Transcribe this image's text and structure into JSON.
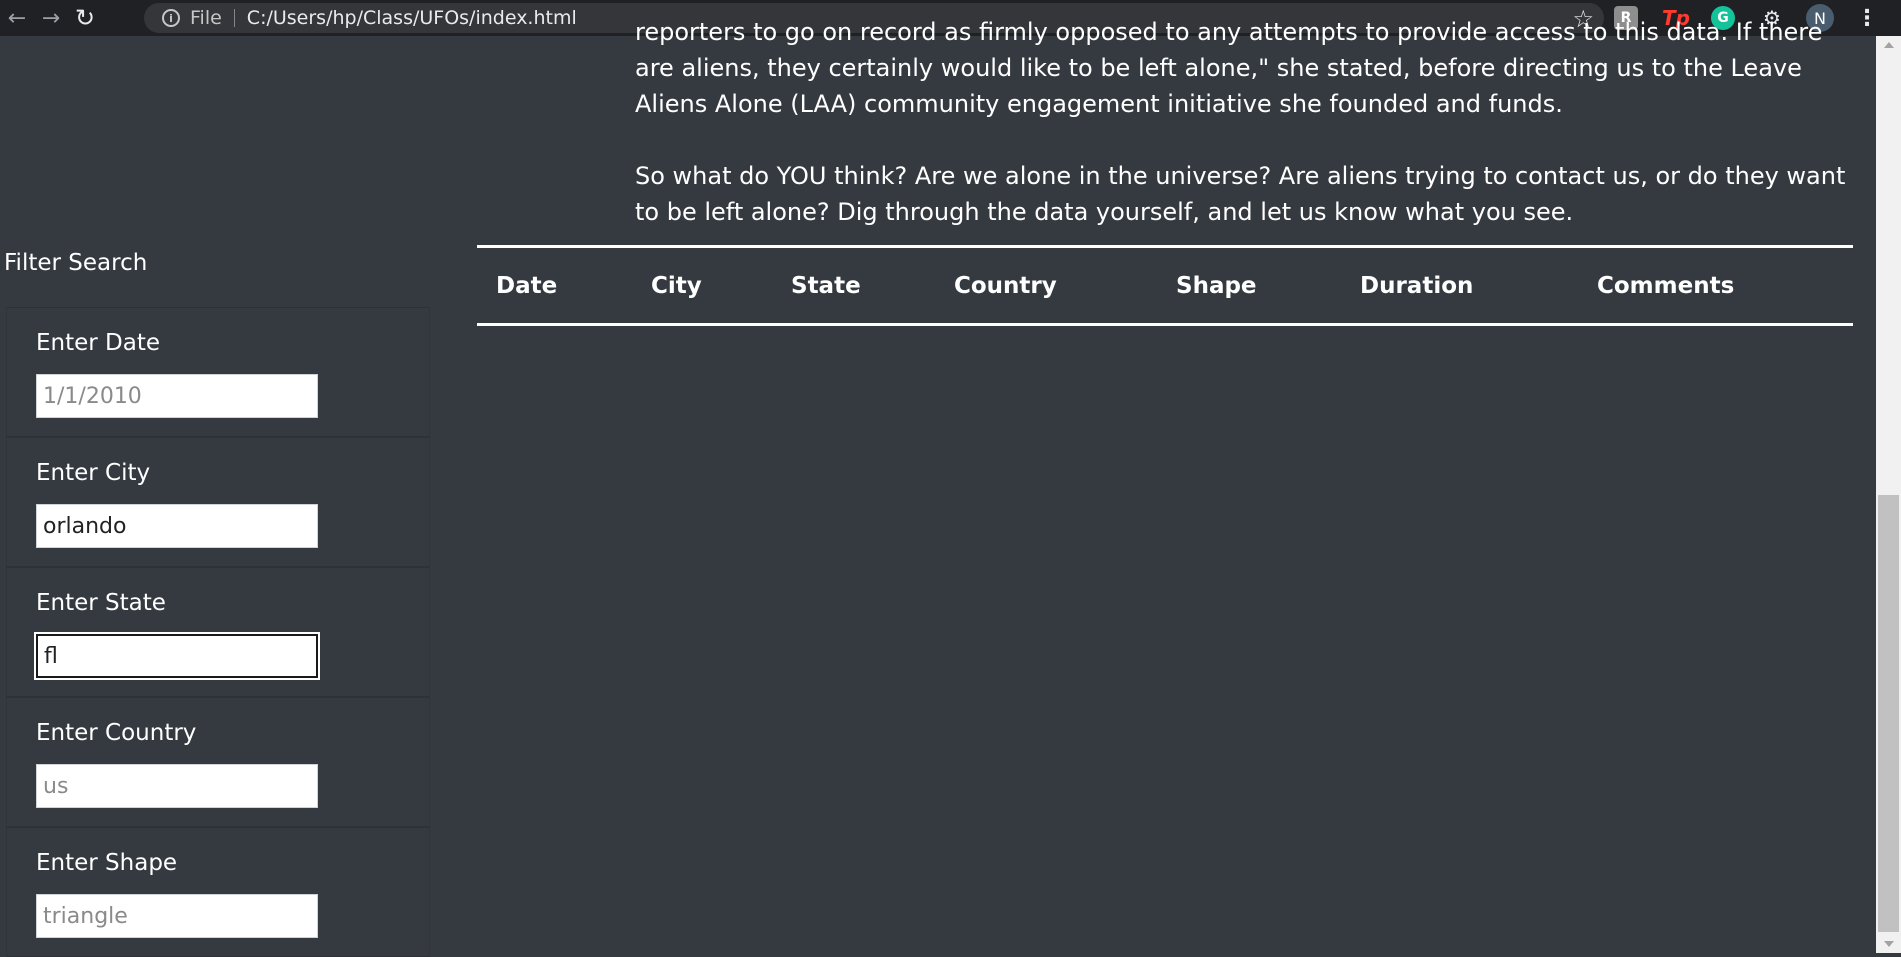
{
  "browser": {
    "scheme": "File",
    "url": "C:/Users/hp/Class/UFOs/index.html",
    "avatar_letter": "N",
    "ext_tp_label": "Tp"
  },
  "article": {
    "paragraph_1": "reporters to go on record as firmly opposed to any attempts to provide access to this data.  If there are aliens, they certainly would like to be left alone,\" she stated, before directing us to the Leave Aliens Alone (LAA) community engagement initiative she founded and funds.",
    "paragraph_2": "So what do YOU think? Are we alone in the universe? Are aliens trying to contact us, or do they want to be left alone? Dig through the data yourself, and let us know what you see."
  },
  "table": {
    "headers": [
      "Date",
      "City",
      "State",
      "Country",
      "Shape",
      "Duration",
      "Comments"
    ]
  },
  "filters": {
    "title": "Filter Search",
    "items": [
      {
        "label": "Enter Date",
        "value": "",
        "placeholder": "1/1/2010"
      },
      {
        "label": "Enter City",
        "value": "orlando",
        "placeholder": ""
      },
      {
        "label": "Enter State",
        "value": "fl",
        "placeholder": ""
      },
      {
        "label": "Enter Country",
        "value": "",
        "placeholder": "us"
      },
      {
        "label": "Enter Shape",
        "value": "",
        "placeholder": "triangle"
      }
    ]
  }
}
